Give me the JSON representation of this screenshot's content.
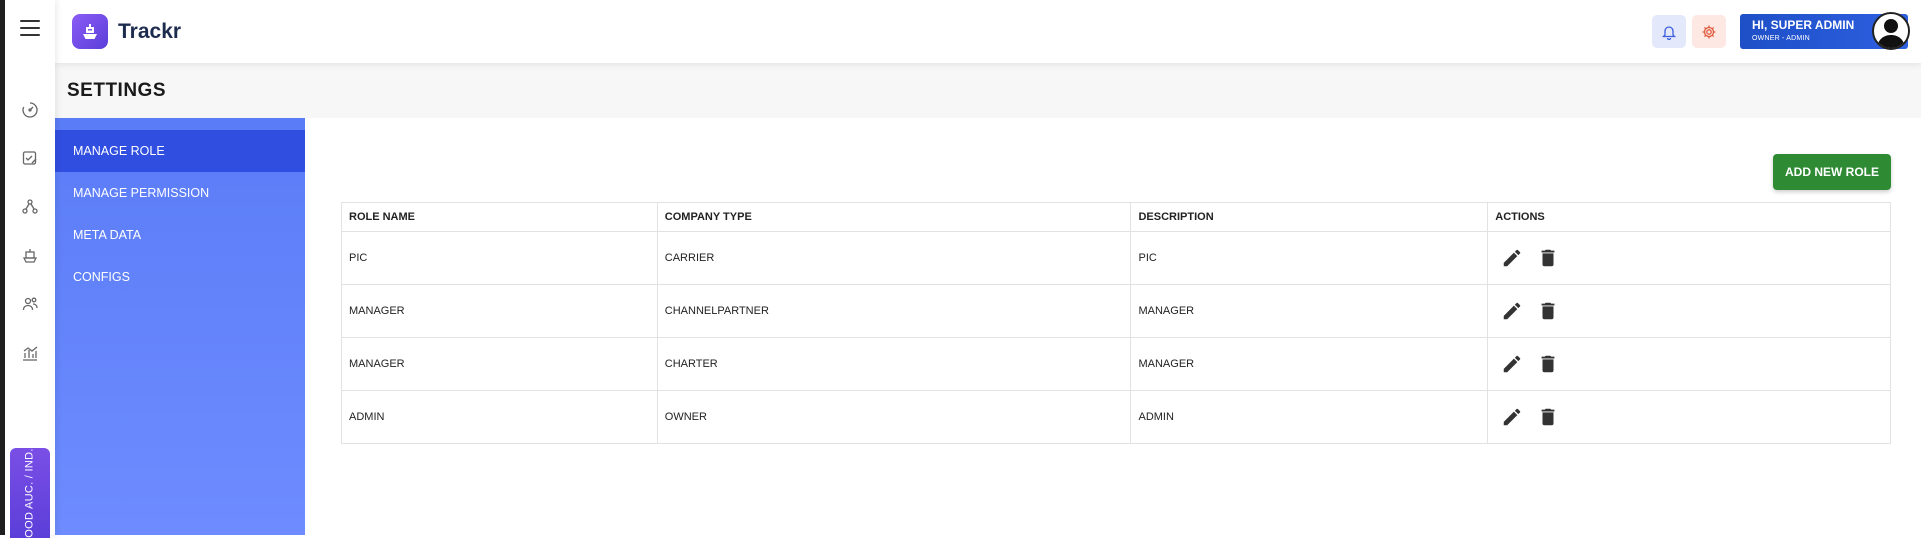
{
  "app": {
    "name": "Trackr"
  },
  "header": {
    "greeting": "HI, SUPER ADMIN",
    "user_role": "OWNER - ADMIN",
    "icons": [
      "bell-icon",
      "gear-icon",
      "user-avatar-icon"
    ]
  },
  "rail": {
    "icons": [
      "dashboard-icon",
      "checklist-icon",
      "network-icon",
      "ship-icon",
      "users-icon",
      "chart-icon"
    ],
    "timezone_label": "OOD AUC. / IND."
  },
  "page": {
    "title": "SETTINGS"
  },
  "sidebar": {
    "items": [
      {
        "label": "MANAGE ROLE",
        "active": true
      },
      {
        "label": "MANAGE PERMISSION",
        "active": false
      },
      {
        "label": "META DATA",
        "active": false
      },
      {
        "label": "CONFIGS",
        "active": false
      }
    ]
  },
  "main": {
    "add_button_label": "ADD NEW ROLE",
    "table": {
      "headers": [
        "ROLE NAME",
        "COMPANY TYPE",
        "DESCRIPTION",
        "ACTIONS"
      ],
      "rows": [
        {
          "role": "PIC",
          "company_type": "CARRIER",
          "description": "PIC"
        },
        {
          "role": "MANAGER",
          "company_type": "CHANNELPARTNER",
          "description": "MANAGER"
        },
        {
          "role": "MANAGER",
          "company_type": "CHARTER",
          "description": "MANAGER"
        },
        {
          "role": "ADMIN",
          "company_type": "OWNER",
          "description": "ADMIN"
        }
      ],
      "row_actions": [
        "edit-icon",
        "delete-icon"
      ]
    }
  },
  "colors": {
    "brand_purple": "#6d4ee6",
    "sidebar_blue": "#6383fa",
    "sidebar_active": "#304ee0",
    "add_button_green": "#2e8b33",
    "user_card_blue": "#1e4fc7"
  }
}
